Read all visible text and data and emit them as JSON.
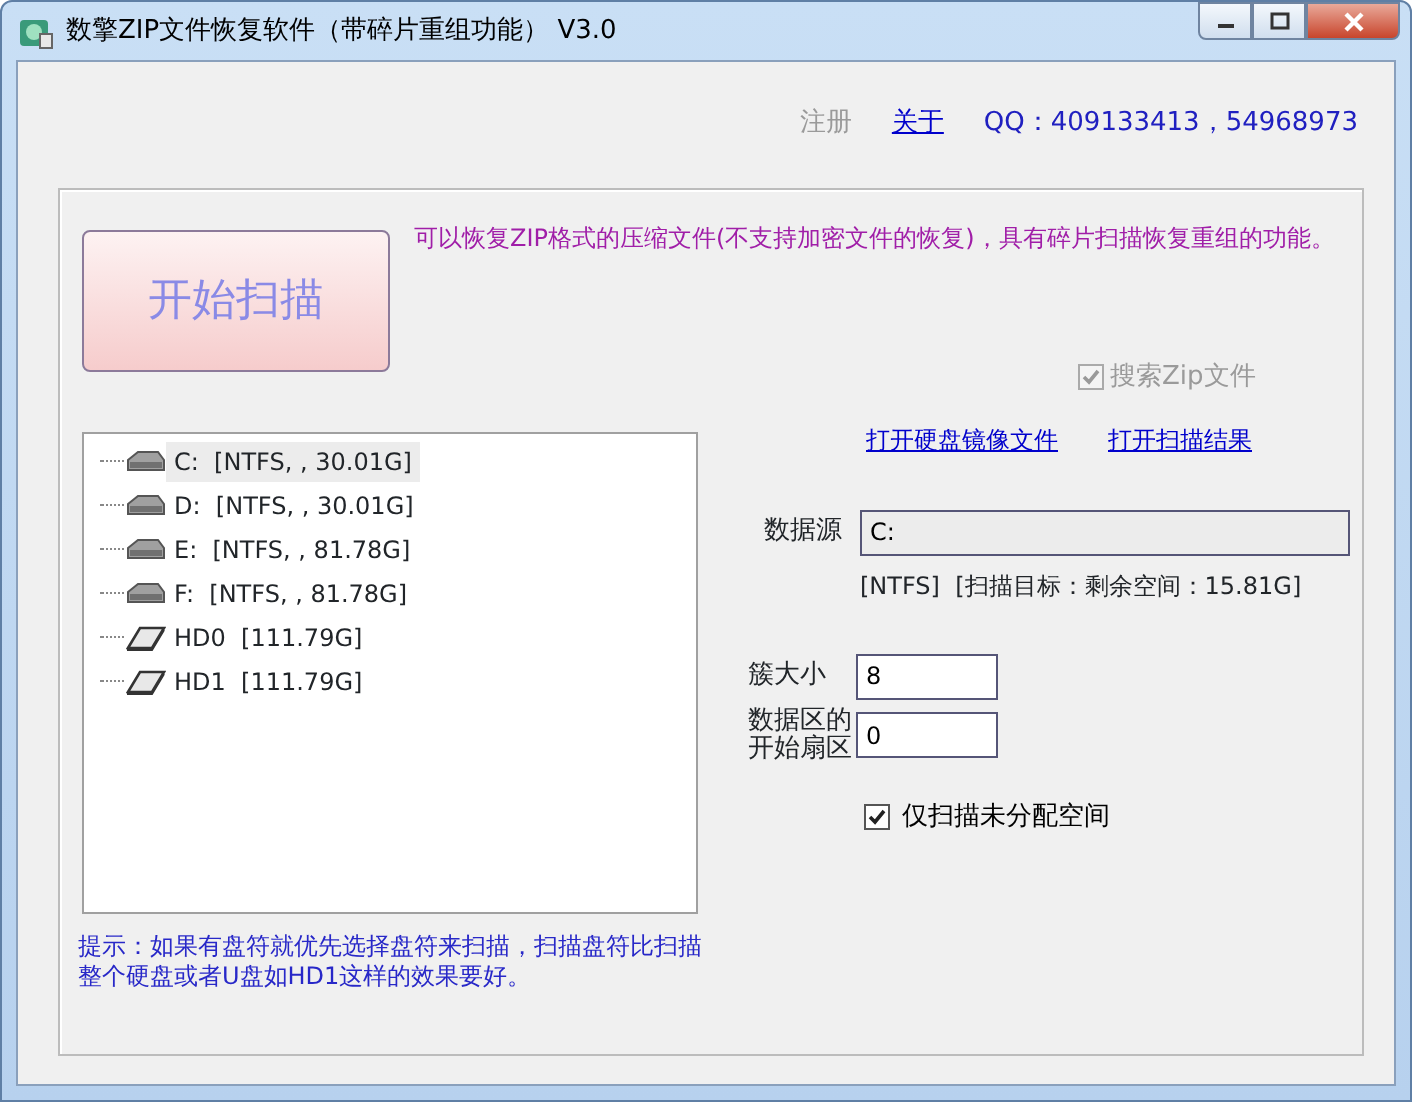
{
  "window": {
    "title": "数擎ZIP文件恢复软件（带碎片重组功能） V3.0"
  },
  "header": {
    "links": [
      {
        "text": "注册",
        "disabled": true
      },
      {
        "text": "关于",
        "disabled": false
      }
    ],
    "qq": "QQ：409133413，54968973"
  },
  "start_button": "开始扫描",
  "description": "可以恢复ZIP格式的压缩文件(不支持加密文件的恢复)，具有碎片扫描恢复重组的功能。",
  "search_zip": {
    "label": "搜索Zip文件",
    "checked": true,
    "disabled": true
  },
  "drive_tree": [
    {
      "kind": "volume",
      "label": "C:",
      "info": "[NTFS, , 30.01G]",
      "selected": true
    },
    {
      "kind": "volume",
      "label": "D:",
      "info": "[NTFS, , 30.01G]",
      "selected": false
    },
    {
      "kind": "volume",
      "label": "E:",
      "info": "[NTFS, , 81.78G]",
      "selected": false
    },
    {
      "kind": "volume",
      "label": "F:",
      "info": "[NTFS, , 81.78G]",
      "selected": false
    },
    {
      "kind": "disk",
      "label": "HD0",
      "info": "[111.79G]",
      "selected": false
    },
    {
      "kind": "disk",
      "label": "HD1",
      "info": "[111.79G]",
      "selected": false
    }
  ],
  "links": [
    "打开硬盘镜像文件",
    "打开扫描结果"
  ],
  "data_source": {
    "label": "数据源",
    "value": "C:",
    "info": "[NTFS]  [扫描目标：剩余空间：15.81G]"
  },
  "fields": [
    {
      "label": "簇大小",
      "value": "8"
    },
    {
      "label": "数据区的开始扇区",
      "value": "0"
    }
  ],
  "only_unallocated": {
    "label": "仅扫描未分配空间",
    "checked": true,
    "disabled": false
  },
  "hint": "提示：如果有盘符就优先选择盘符来扫描，扫描盘符比扫描整个硬盘或者U盘如HD1这样的效果要好。"
}
